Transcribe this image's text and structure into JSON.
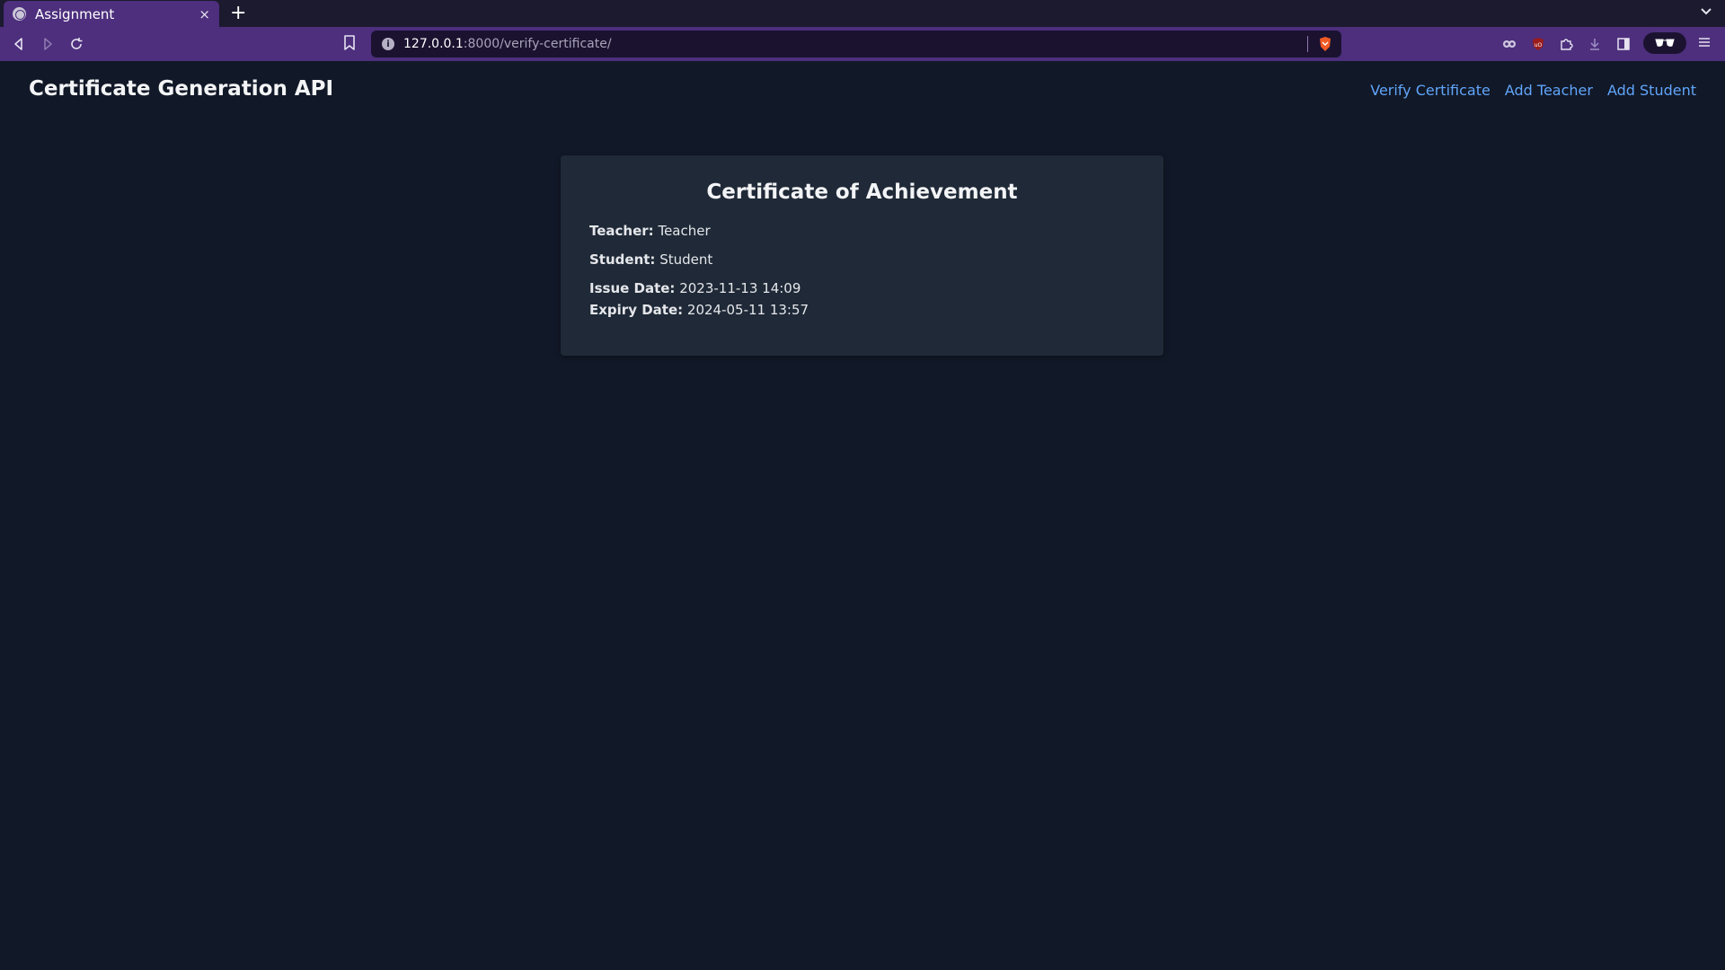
{
  "browser": {
    "tab_title": "Assignment",
    "tab_close": "×",
    "new_tab": "+",
    "url_host": "127.0.0.1",
    "url_path": ":8000/verify-certificate/"
  },
  "header": {
    "title": "Certificate Generation API",
    "nav": [
      {
        "label": "Verify Certificate"
      },
      {
        "label": "Add Teacher"
      },
      {
        "label": "Add Student"
      }
    ]
  },
  "certificate": {
    "title": "Certificate of Achievement",
    "teacher_label": "Teacher:",
    "teacher_value": "Teacher",
    "student_label": "Student:",
    "student_value": "Student",
    "issue_label": "Issue Date:",
    "issue_value": "2023-11-13 14:09",
    "expiry_label": "Expiry Date:",
    "expiry_value": "2024-05-11 13:57"
  },
  "colors": {
    "background": "#111827",
    "card": "#1f2937",
    "link": "#60a5fa",
    "browser_accent": "#4d2f7d"
  }
}
